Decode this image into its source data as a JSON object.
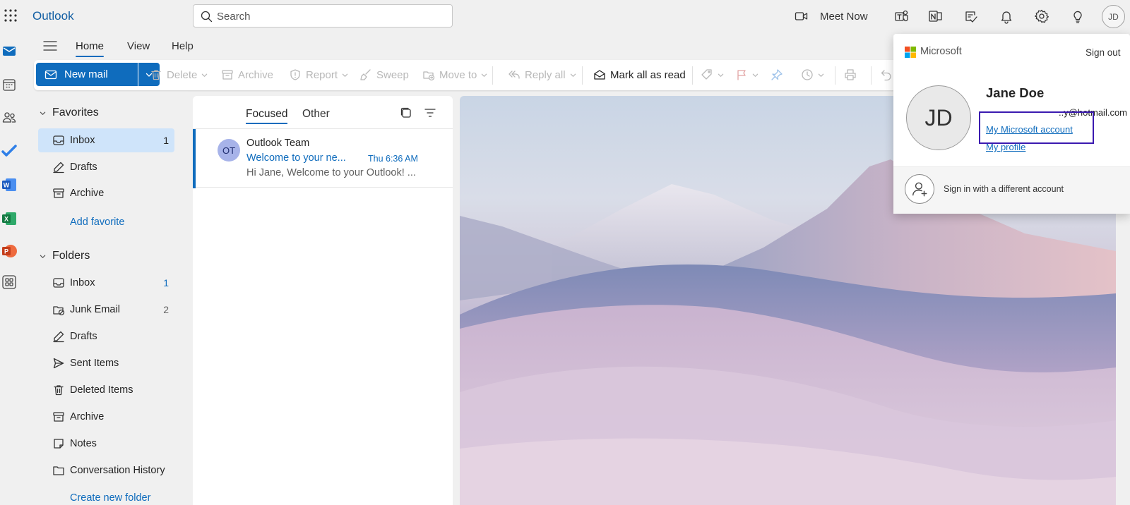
{
  "app": {
    "title": "Outlook"
  },
  "search": {
    "placeholder": "Search"
  },
  "topbar": {
    "meet_now": "Meet Now",
    "avatar_initials": "JD"
  },
  "ribbon": {
    "tabs": [
      "Home",
      "View",
      "Help"
    ]
  },
  "toolbar": {
    "new_mail": "New mail",
    "delete": "Delete",
    "archive": "Archive",
    "report": "Report",
    "sweep": "Sweep",
    "move_to": "Move to",
    "reply_all": "Reply all",
    "mark_all_read": "Mark all as read"
  },
  "favorites": {
    "title": "Favorites",
    "items": [
      {
        "label": "Inbox",
        "count": "1"
      },
      {
        "label": "Drafts",
        "count": ""
      },
      {
        "label": "Archive",
        "count": ""
      }
    ],
    "add": "Add favorite"
  },
  "folders": {
    "title": "Folders",
    "items": [
      {
        "label": "Inbox",
        "count": "1"
      },
      {
        "label": "Junk Email",
        "count": "2"
      },
      {
        "label": "Drafts",
        "count": ""
      },
      {
        "label": "Sent Items",
        "count": ""
      },
      {
        "label": "Deleted Items",
        "count": ""
      },
      {
        "label": "Archive",
        "count": ""
      },
      {
        "label": "Notes",
        "count": ""
      },
      {
        "label": "Conversation History",
        "count": ""
      }
    ],
    "create": "Create new folder"
  },
  "message_list": {
    "tabs": [
      "Focused",
      "Other"
    ],
    "messages": [
      {
        "initials": "OT",
        "sender": "Outlook Team",
        "subject": "Welcome to your ne...",
        "time": "Thu 6:36 AM",
        "preview": "Hi Jane, Welcome to your Outlook! ..."
      }
    ]
  },
  "account_card": {
    "brand": "Microsoft",
    "sign_out": "Sign out",
    "initials": "JD",
    "name": "Jane Doe",
    "email": "..y@hotmail.com",
    "my_account": "My Microsoft account",
    "my_profile": "My profile",
    "different_account": "Sign in with a different account"
  },
  "colors": {
    "accent": "#0f6cbd",
    "highlight_box": "#3b1ab0"
  }
}
